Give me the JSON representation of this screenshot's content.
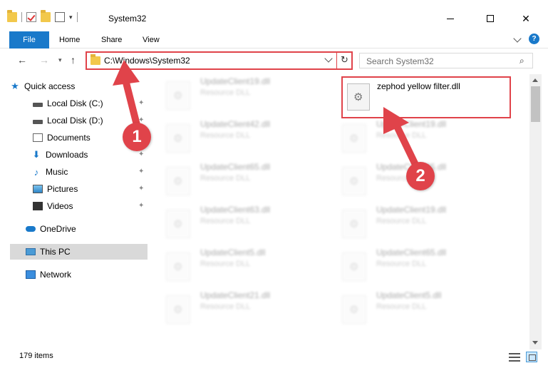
{
  "window": {
    "title": "System32",
    "minimize_label": "",
    "maximize_label": "",
    "close_label": "✕"
  },
  "ribbon": {
    "tabs": [
      "File",
      "Home",
      "Share",
      "View"
    ],
    "help_label": "?"
  },
  "navigation": {
    "back": "←",
    "forward": "→",
    "recent": "▾",
    "up": "↑",
    "address": "C:\\Windows\\System32",
    "refresh": "↻",
    "search_placeholder": "Search System32",
    "search_icon": "⌕"
  },
  "sidebar": {
    "items": [
      {
        "label": "Quick access",
        "icon": "star-icon",
        "pinned": false
      },
      {
        "label": "Local Disk (C:)",
        "icon": "disk-icon",
        "pinned": true
      },
      {
        "label": "Local Disk (D:)",
        "icon": "disk-icon",
        "pinned": true
      },
      {
        "label": "Documents",
        "icon": "documents-icon",
        "pinned": true
      },
      {
        "label": "Downloads",
        "icon": "downloads-icon",
        "pinned": true
      },
      {
        "label": "Music",
        "icon": "music-icon",
        "pinned": true
      },
      {
        "label": "Pictures",
        "icon": "pictures-icon",
        "pinned": true
      },
      {
        "label": "Videos",
        "icon": "videos-icon",
        "pinned": true
      },
      {
        "label": "OneDrive",
        "icon": "onedrive-icon",
        "pinned": false
      },
      {
        "label": "This PC",
        "icon": "this-pc-icon",
        "pinned": false,
        "selected": true
      },
      {
        "label": "Network",
        "icon": "network-icon",
        "pinned": false
      }
    ],
    "pin_glyph": "📌"
  },
  "files": {
    "type_label": "Resource DLL",
    "left_column": [
      "UpdateClient19.dll",
      "UpdateClient42.dll",
      "UpdateClient65.dll",
      "UpdateClient63.dll",
      "UpdateClient5.dll",
      "UpdateClient21.dll"
    ],
    "right_column": [
      "UpdateClient19.dll",
      "UpdateClient65.dll",
      "UpdateClient19.dll",
      "UpdateClient65.dll",
      "UpdateClient5.dll"
    ],
    "highlighted": "zephod yellow filter.dll"
  },
  "status": {
    "item_count": "179 items"
  },
  "annotations": {
    "step_1": "1",
    "step_2": "2",
    "color": "#e0434a"
  }
}
